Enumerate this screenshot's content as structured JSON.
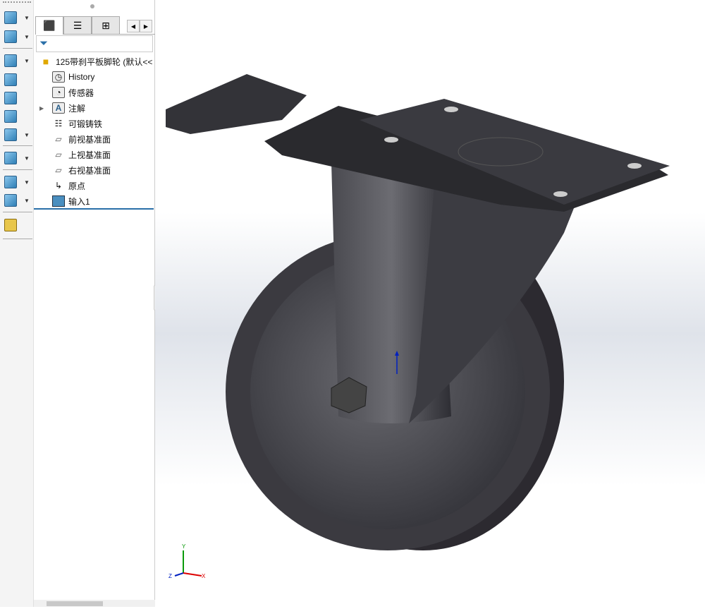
{
  "toolbar": {
    "icons": [
      "extruded-boss-icon",
      "extruded-cut-icon",
      "fillet-icon",
      "rib-icon",
      "shell-icon",
      "chamfer-icon",
      "intersect-icon",
      "linear-pattern-icon",
      "reference-geometry-icon",
      "curves-icon",
      "measure-icon"
    ]
  },
  "feature_tree": {
    "root": "125带刹平板脚轮  (默认<<",
    "items": [
      {
        "label": "History",
        "icon": "history-folder-icon"
      },
      {
        "label": "传感器",
        "icon": "sensors-folder-icon"
      },
      {
        "label": "注解",
        "icon": "annotations-folder-icon",
        "expandable": true
      },
      {
        "label": "可锻铸铁",
        "icon": "material-icon"
      },
      {
        "label": "前视基准面",
        "icon": "plane-icon"
      },
      {
        "label": "上视基准面",
        "icon": "plane-icon"
      },
      {
        "label": "右视基准面",
        "icon": "plane-icon"
      },
      {
        "label": "原点",
        "icon": "origin-icon"
      },
      {
        "label": "输入1",
        "icon": "imported-body-icon"
      }
    ]
  },
  "triad": {
    "x": "X",
    "y": "Y",
    "z": "Z"
  },
  "colors": {
    "accent": "#2a6fa8",
    "model": "#3a3a3e"
  }
}
